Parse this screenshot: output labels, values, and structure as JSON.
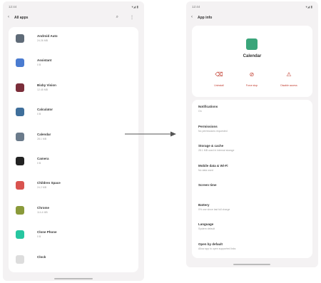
{
  "left": {
    "status_time": "12:44",
    "status_icons": "▾◢ ▮",
    "title": "All apps",
    "apps": [
      {
        "name": "Android Auto",
        "size": "24.26 MB",
        "color": "#5f6b78",
        "icon": "android-auto-icon"
      },
      {
        "name": "Assistant",
        "size": "0 B",
        "color": "#4a7bd0",
        "icon": "assistant-icon"
      },
      {
        "name": "Bixby Vision",
        "size": "12.45 MB",
        "color": "#7b2e3a",
        "icon": "bixby-vision-icon"
      },
      {
        "name": "Calculator",
        "size": "0 B",
        "color": "#3f6f9b",
        "icon": "calculator-icon"
      },
      {
        "name": "Calendar",
        "size": "28.1 MB",
        "color": "#6b7b8b",
        "icon": "calendar-icon"
      },
      {
        "name": "Camera",
        "size": "0 B",
        "color": "#222222",
        "icon": "camera-icon"
      },
      {
        "name": "Children Space",
        "size": "24.2 MB",
        "color": "#d9534f",
        "icon": "children-space-icon"
      },
      {
        "name": "Chrome",
        "size": "114.4 MB",
        "color": "#8a9a3a",
        "icon": "chrome-icon"
      },
      {
        "name": "Clone Phone",
        "size": "0 B",
        "color": "#26c6a0",
        "icon": "clone-phone-icon"
      },
      {
        "name": "Clock",
        "size": "",
        "color": "#dddddd",
        "icon": "clock-icon"
      }
    ]
  },
  "right": {
    "status_time": "12:44",
    "status_icons": "▾◢ ▮",
    "title": "App info",
    "app_name": "Calendar",
    "app_color": "#3aa57a",
    "actions": [
      {
        "label": "Uninstall",
        "icon": "uninstall-icon",
        "glyph": "⌫"
      },
      {
        "label": "Force stop",
        "icon": "force-stop-icon",
        "glyph": "⊘"
      },
      {
        "label": "Disable access",
        "icon": "disable-icon",
        "glyph": "⚠"
      }
    ],
    "settings": [
      {
        "title": "Notifications",
        "sub": "On"
      },
      {
        "title": "Permissions",
        "sub": "No permissions requested"
      },
      {
        "title": "Storage & cache",
        "sub": "28.1 MB used in internal storage"
      },
      {
        "title": "Mobile data & Wi-Fi",
        "sub": "No data used"
      },
      {
        "title": "Screen time",
        "sub": ""
      },
      {
        "title": "Battery",
        "sub": "0% use since last full charge"
      },
      {
        "title": "Language",
        "sub": "System default"
      },
      {
        "title": "Open by default",
        "sub": "Allow app to open supported links"
      }
    ]
  },
  "accent": "#c0392b"
}
